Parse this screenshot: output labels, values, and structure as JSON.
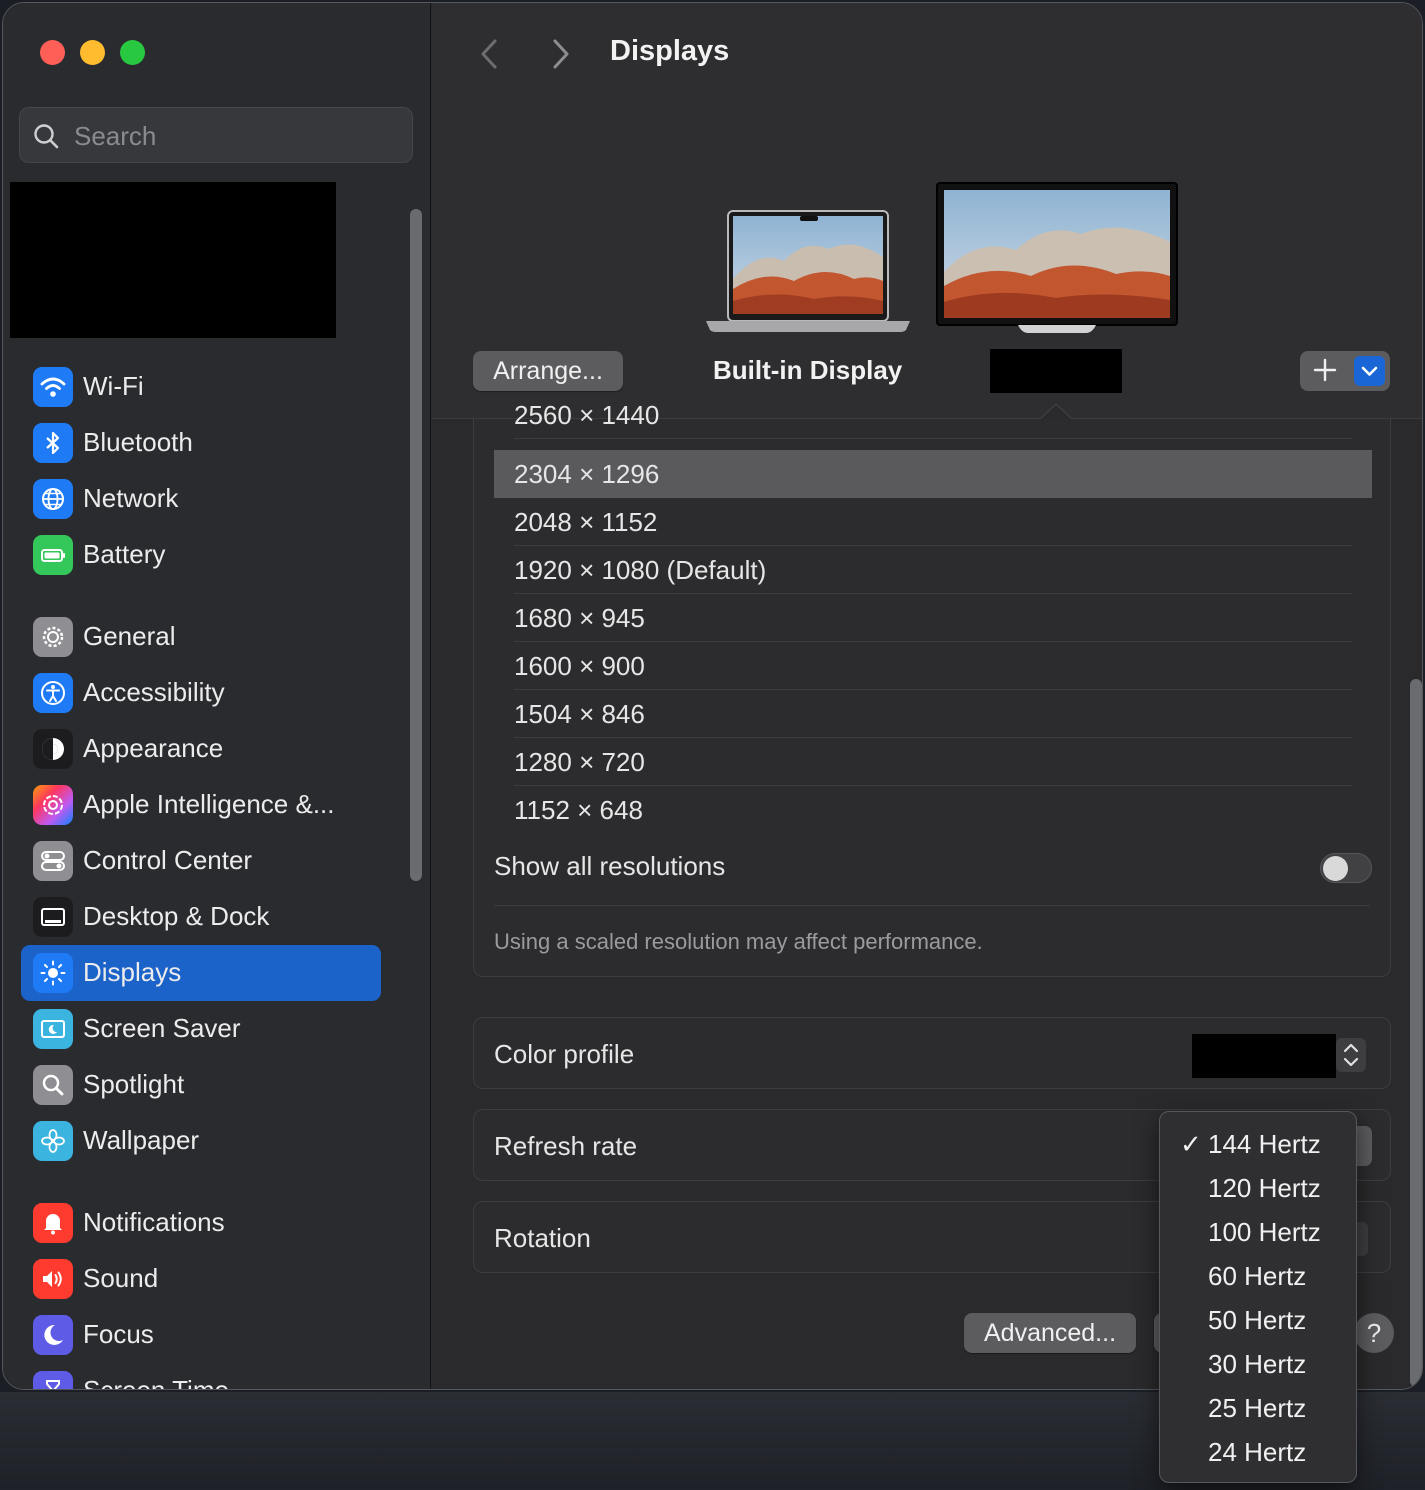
{
  "window": {
    "title": "Displays"
  },
  "search": {
    "placeholder": "Search"
  },
  "sidebar": {
    "items": [
      {
        "label": "Wi-Fi",
        "icon": "wifi-icon",
        "color": "#1e7bf5"
      },
      {
        "label": "Bluetooth",
        "icon": "bluetooth-icon",
        "color": "#1e7bf5"
      },
      {
        "label": "Network",
        "icon": "globe-icon",
        "color": "#1e7bf5"
      },
      {
        "label": "Battery",
        "icon": "battery-icon",
        "color": "#34c759"
      },
      {
        "label": "General",
        "icon": "gear-icon",
        "color": "#8e8e93"
      },
      {
        "label": "Accessibility",
        "icon": "accessibility-icon",
        "color": "#1e7bf5"
      },
      {
        "label": "Appearance",
        "icon": "appearance-icon",
        "color": "#1c1c1e"
      },
      {
        "label": "Apple Intelligence &...",
        "icon": "apple-intelligence-icon",
        "color": "#c957e6"
      },
      {
        "label": "Control Center",
        "icon": "control-center-icon",
        "color": "#8e8e93"
      },
      {
        "label": "Desktop & Dock",
        "icon": "desktop-dock-icon",
        "color": "#1c1c1e"
      },
      {
        "label": "Displays",
        "icon": "sun-icon",
        "color": "#1e7bf5",
        "active": true
      },
      {
        "label": "Screen Saver",
        "icon": "screen-saver-icon",
        "color": "#3cb4e0"
      },
      {
        "label": "Spotlight",
        "icon": "magnifier-icon",
        "color": "#8e8e93"
      },
      {
        "label": "Wallpaper",
        "icon": "flower-icon",
        "color": "#3cb4e0"
      },
      {
        "label": "Notifications",
        "icon": "bell-icon",
        "color": "#ff3b30"
      },
      {
        "label": "Sound",
        "icon": "speaker-icon",
        "color": "#ff3b30"
      },
      {
        "label": "Focus",
        "icon": "moon-icon",
        "color": "#5e5ce6"
      },
      {
        "label": "Screen Time",
        "icon": "hourglass-icon",
        "color": "#5e5ce6"
      }
    ]
  },
  "header": {
    "arrange_label": "Arrange...",
    "builtin_display_label": "Built-in Display"
  },
  "resolutions": {
    "items": [
      "2560 × 1440",
      "2304 × 1296",
      "2048 × 1152",
      "1920 × 1080 (Default)",
      "1680 × 945",
      "1600 × 900",
      "1504 × 846",
      "1280 × 720",
      "1152 × 648"
    ],
    "selected": "2304 × 1296",
    "show_all_label": "Show all resolutions",
    "show_all_enabled": false,
    "note": "Using a scaled resolution may affect performance."
  },
  "settings": {
    "color_profile_label": "Color profile",
    "refresh_rate_label": "Refresh rate",
    "rotation_label": "Rotation"
  },
  "buttons": {
    "advanced_label": "Advanced...",
    "help_label": "?"
  },
  "refresh_menu": {
    "check": "✓",
    "options": [
      "144 Hertz",
      "120 Hertz",
      "100 Hertz",
      "60 Hertz",
      "50 Hertz",
      "30 Hertz",
      "25 Hertz",
      "24 Hertz"
    ],
    "selected": "144 Hertz"
  },
  "colors": {
    "accent": "#1b62c9",
    "close": "#ff5f57",
    "minimize": "#febc2e",
    "maximize": "#28c840"
  }
}
